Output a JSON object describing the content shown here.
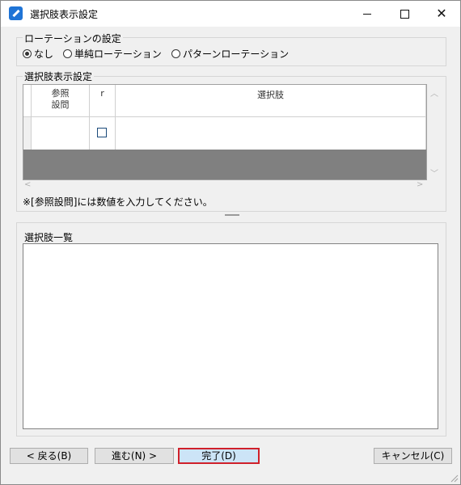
{
  "window": {
    "title": "選択肢表示設定",
    "min_glyph": "",
    "max_glyph": "",
    "close_glyph": "✕"
  },
  "rotation": {
    "title": "ローテーションの設定",
    "options": [
      {
        "label": "なし",
        "selected": true
      },
      {
        "label": "単純ローテーション",
        "selected": false
      },
      {
        "label": "パターンローテーション",
        "selected": false
      }
    ]
  },
  "choice_display": {
    "title": "選択肢表示設定",
    "columns": [
      "参照設問",
      "r",
      "選択肢"
    ],
    "col_ref_line1": "参照",
    "col_ref_line2": "設問",
    "col_r": "r",
    "col_choice": "選択肢",
    "rows": [
      {
        "ref": "",
        "r_checked": false,
        "choice": ""
      }
    ],
    "note": "※[参照設問]には数値を入力してください。"
  },
  "choice_list": {
    "title": "選択肢一覧",
    "items": []
  },
  "buttons": {
    "back": "< 戻る(B)",
    "next": "進む(N) >",
    "done": "完了(D)",
    "cancel": "キャンセル(C)"
  }
}
